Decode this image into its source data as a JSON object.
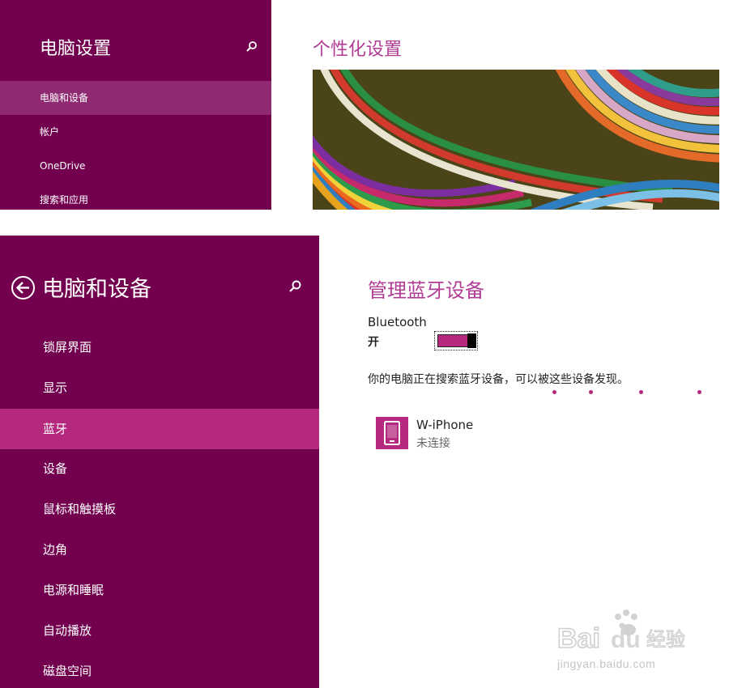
{
  "top_panel": {
    "sidebar": {
      "title": "电脑设置",
      "search_icon": "search-icon",
      "items": [
        {
          "label": "电脑和设备",
          "selected": true
        },
        {
          "label": "帐户",
          "selected": false
        },
        {
          "label": "OneDrive",
          "selected": false
        },
        {
          "label": "搜索和应用",
          "selected": false
        }
      ]
    },
    "main": {
      "heading": "个性化设置",
      "banner_image": "colored-paper-strips"
    }
  },
  "bottom_panel": {
    "sidebar": {
      "back_icon": "back-arrow-icon",
      "title": "电脑和设备",
      "search_icon": "search-icon",
      "items": [
        {
          "label": "锁屏界面",
          "selected": false
        },
        {
          "label": "显示",
          "selected": false
        },
        {
          "label": "蓝牙",
          "selected": true
        },
        {
          "label": "设备",
          "selected": false
        },
        {
          "label": "鼠标和触摸板",
          "selected": false
        },
        {
          "label": "边角",
          "selected": false
        },
        {
          "label": "电源和睡眠",
          "selected": false
        },
        {
          "label": "自动播放",
          "selected": false
        },
        {
          "label": "磁盘空间",
          "selected": false
        }
      ]
    },
    "main": {
      "heading": "管理蓝牙设备",
      "bluetooth_label": "Bluetooth",
      "bluetooth_state": "开",
      "bluetooth_on": true,
      "status_text": "你的电脑正在搜索蓝牙设备，可以被这些设备发现。",
      "devices": [
        {
          "name": "W-iPhone",
          "status": "未连接",
          "icon": "phone-icon"
        }
      ]
    }
  },
  "watermark": {
    "text": "Baidu经验",
    "subtext": "jingyan.baidu.com"
  },
  "colors": {
    "sidebar_bg": "#72004f",
    "top_selected_bg": "#8f2a72",
    "selected_bg": "#b4287d",
    "accent": "#b03c94"
  }
}
